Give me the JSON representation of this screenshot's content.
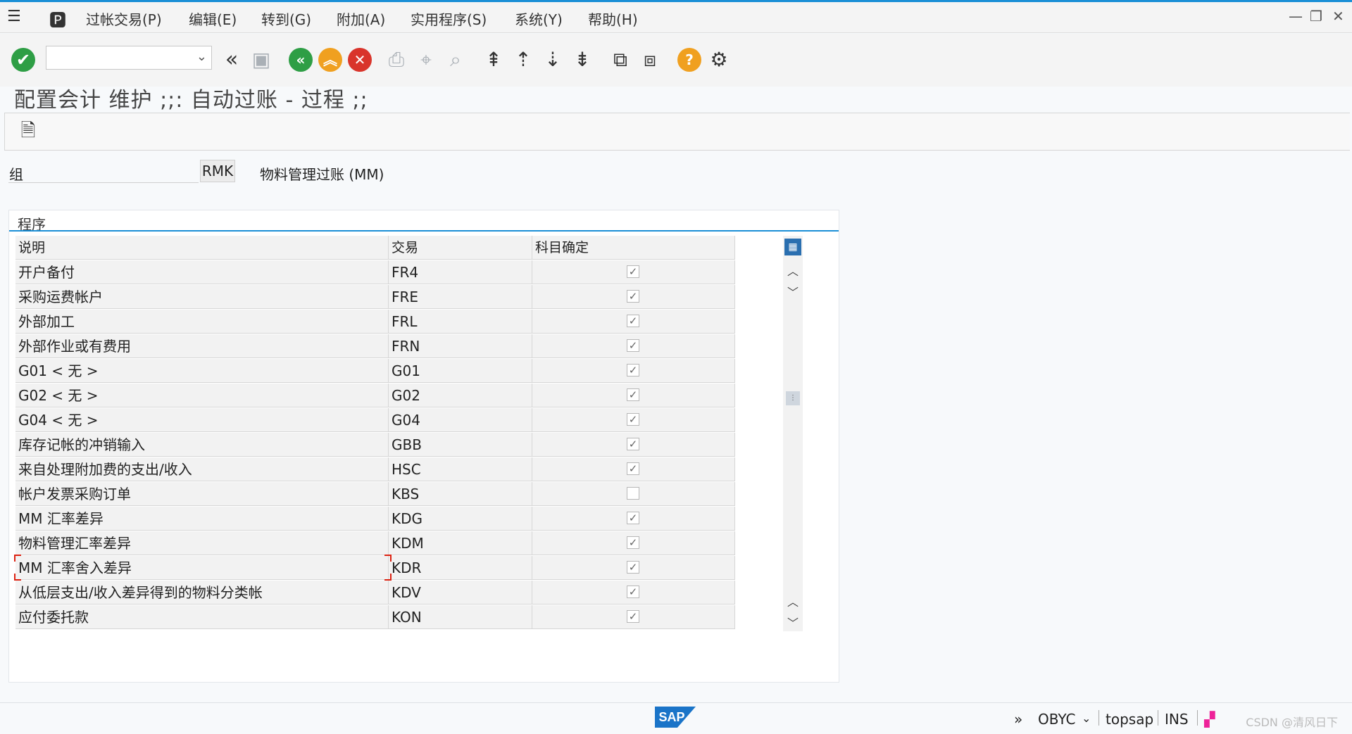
{
  "menu": {
    "items": [
      "过帐交易(P)",
      "编辑(E)",
      "转到(G)",
      "附加(A)",
      "实用程序(S)",
      "系统(Y)",
      "帮助(H)"
    ]
  },
  "toolbar": {
    "command_value": "",
    "icons": [
      "check-icon",
      "save-icon",
      "back-icon",
      "exit-icon",
      "cancel-icon",
      "print-icon",
      "find-icon",
      "find-next-icon",
      "first-page-icon",
      "prev-page-icon",
      "next-page-icon",
      "last-page-icon",
      "new-session-icon",
      "shortcut-icon",
      "help-icon",
      "settings-icon"
    ]
  },
  "page": {
    "title": "配置会计 维护 ;;: 自动过账 - 过程 ;;"
  },
  "group": {
    "label": "组",
    "value": "RMK",
    "description": "物料管理过账 (MM)"
  },
  "frame": {
    "title": "程序"
  },
  "table": {
    "columns": [
      "说明",
      "交易",
      "科目确定"
    ],
    "rows": [
      {
        "desc": "开户备付",
        "code": "FR4",
        "checked": true
      },
      {
        "desc": "采购运费帐户",
        "code": "FRE",
        "checked": true
      },
      {
        "desc": "外部加工",
        "code": "FRL",
        "checked": true
      },
      {
        "desc": "外部作业或有费用",
        "code": "FRN",
        "checked": true
      },
      {
        "desc": "G01 < 无 >",
        "code": "G01",
        "checked": true
      },
      {
        "desc": "G02 < 无 >",
        "code": "G02",
        "checked": true
      },
      {
        "desc": "G04 < 无 >",
        "code": "G04",
        "checked": true
      },
      {
        "desc": "库存记帐的冲销输入",
        "code": "GBB",
        "checked": true
      },
      {
        "desc": "来自处理附加费的支出/收入",
        "code": "HSC",
        "checked": true
      },
      {
        "desc": "帐户发票采购订单",
        "code": "KBS",
        "checked": false
      },
      {
        "desc": "MM 汇率差异",
        "code": "KDG",
        "checked": true
      },
      {
        "desc": "物料管理汇率差异",
        "code": "KDM",
        "checked": true
      },
      {
        "desc": "MM 汇率舍入差异",
        "code": "KDR",
        "checked": true
      },
      {
        "desc": "从低层支出/收入差异得到的物料分类帐",
        "code": "KDV",
        "checked": true
      },
      {
        "desc": "应付委托款",
        "code": "KON",
        "checked": true
      }
    ]
  },
  "status": {
    "transaction": "OBYC",
    "server": "topsap",
    "mode": "INS",
    "watermark": "CSDN @清风日下"
  },
  "colors": {
    "accent": "#1a8fd6",
    "ok_green": "#2e9e45",
    "exit_orange": "#f0a020",
    "cancel_red": "#d9342b"
  }
}
